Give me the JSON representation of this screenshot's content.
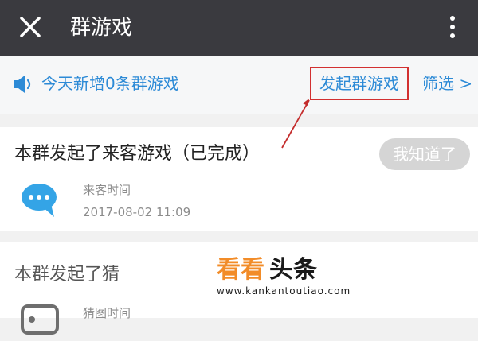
{
  "topbar": {
    "title": "群游戏",
    "close_icon": "close-icon",
    "more_icon": "more-vertical-icon"
  },
  "notice": {
    "icon": "speaker-icon",
    "text": "今天新增0条群游戏",
    "start_button": "发起群游戏",
    "filter_button": "筛选 >"
  },
  "cards": [
    {
      "title": "本群发起了来客游戏（已完成）",
      "ack_button": "我知道了",
      "icon": "chat-bubble-icon",
      "label": "来客时间",
      "time": "2017-08-02 11:09"
    },
    {
      "title": "本群发起了猜",
      "icon": "image-card-icon",
      "label": "猜图时间"
    }
  ],
  "watermark": {
    "main_orange": "看看",
    "main_black": "头条",
    "url": "www.kankantoutiao.com"
  },
  "colors": {
    "topbar_bg": "#3a3a3f",
    "link_blue": "#2c8ad6",
    "highlight_red": "#d23030",
    "brand_orange": "#f28c28"
  }
}
